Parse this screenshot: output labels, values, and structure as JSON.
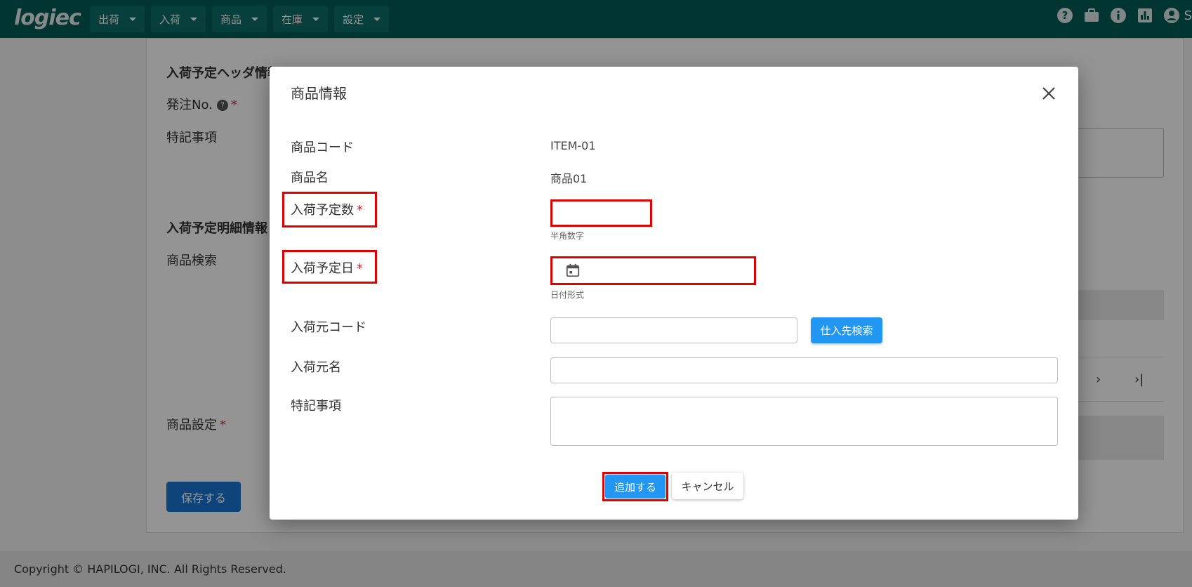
{
  "header": {
    "logo": "logiec",
    "nav": [
      {
        "label": "出荷"
      },
      {
        "label": "入荷"
      },
      {
        "label": "商品"
      },
      {
        "label": "在庫"
      },
      {
        "label": "設定"
      }
    ],
    "user_initial": "S"
  },
  "background": {
    "section1_title": "入荷予定ヘッダ情報",
    "order_no_label": "発注No.",
    "notes_label": "特記事項",
    "section2_title": "入荷予定明細情報",
    "product_search_label": "商品検索",
    "product_settings_label": "商品設定",
    "save_label": "保存する",
    "pager_next": "›",
    "pager_last": "›|"
  },
  "modal": {
    "title": "商品情報",
    "product_code_label": "商品コード",
    "product_code_value": "ITEM-01",
    "product_name_label": "商品名",
    "product_name_value": "商品01",
    "quantity_label": "入荷予定数",
    "quantity_value": "",
    "quantity_hint": "半角数字",
    "date_label": "入荷予定日",
    "date_value": "",
    "date_hint": "日付形式",
    "supplier_code_label": "入荷元コード",
    "supplier_code_value": "",
    "supplier_search_label": "仕入先検索",
    "supplier_name_label": "入荷元名",
    "supplier_name_value": "",
    "notes_label": "特記事項",
    "notes_value": "",
    "required_mark": "*",
    "add_label": "追加する",
    "cancel_label": "キャンセル"
  },
  "footer": {
    "copyright": "Copyright © HAPILOGI, INC. All Rights Reserved."
  },
  "colors": {
    "header_bg": "#005c57",
    "primary": "#2196f3",
    "highlight": "#e00000",
    "required": "#d32f2f"
  }
}
